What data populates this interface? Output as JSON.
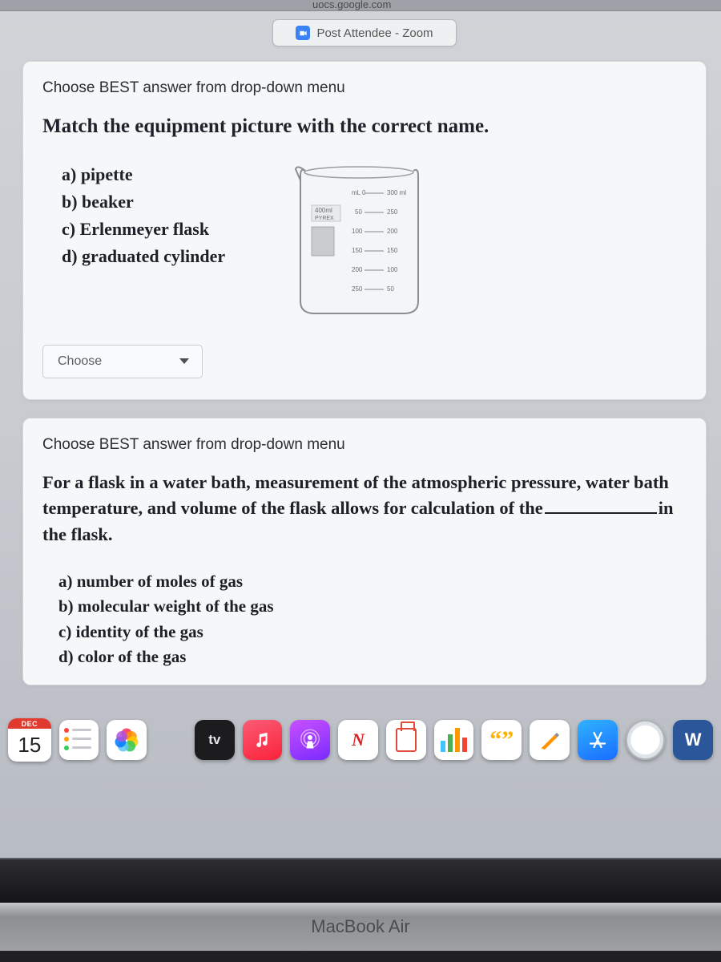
{
  "browser": {
    "url_fragment": "uocs.google.com",
    "tab_title": "Post Attendee - Zoom"
  },
  "question1": {
    "instruction": "Choose BEST answer from drop-down menu",
    "heading": "Match the equipment picture with the correct name.",
    "options": {
      "a": "a)  pipette",
      "b": "b)  beaker",
      "c": "c)  Erlenmeyer flask",
      "d": "d)  graduated cylinder"
    },
    "dropdown_label": "Choose",
    "beaker_image": {
      "capacity_label": "400ml",
      "brand": "PYREX",
      "gradations_left": [
        "mL 0",
        "50",
        "100",
        "150",
        "200",
        "250"
      ],
      "gradations_right": [
        "300 ml",
        "250",
        "200",
        "150",
        "100",
        "50"
      ]
    }
  },
  "question2": {
    "instruction": "Choose BEST answer from drop-down menu",
    "text_before": "For a flask in a water bath, measurement of the atmospheric pressure, water bath temperature, and volume of the flask allows for calculation of the",
    "text_after": "in the flask.",
    "options": {
      "a": "a)  number of moles of gas",
      "b": "b)  molecular weight of the gas",
      "c": "c)  identity of the gas",
      "d": "d)  color of the gas"
    }
  },
  "dock": {
    "calendar_month": "DEC",
    "calendar_day": "15",
    "tv_label": "tv"
  },
  "device_label": "MacBook Air"
}
